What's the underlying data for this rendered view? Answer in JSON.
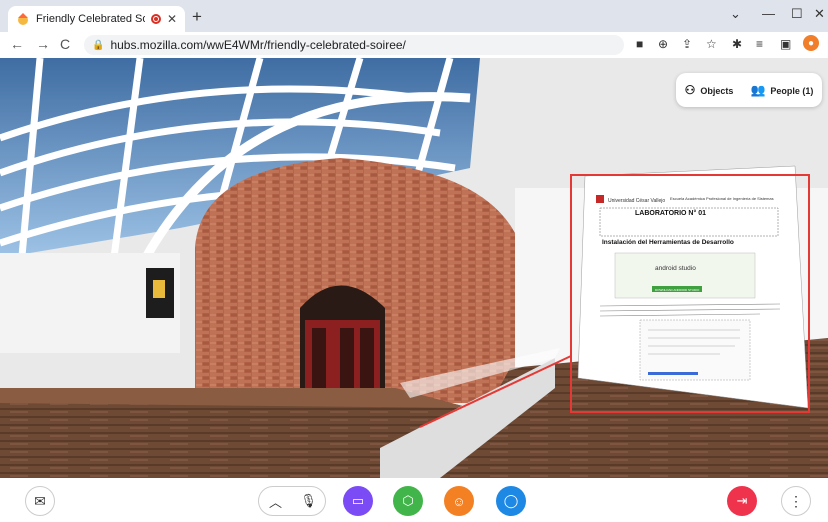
{
  "browser": {
    "tab_title": "Friendly Celebrated Soiree | ",
    "url": "hubs.mozilla.com/wwE4WMr/friendly-celebrated-soiree/",
    "window_controls": [
      "⌄",
      "—",
      "☐",
      "✕"
    ]
  },
  "scene": {
    "objects_label": "Objects",
    "people_label": "People (1)",
    "document": {
      "header_left": "Universidad César Vallejo",
      "header_right": "Escuela Académica Profesional de Ingeniería de Sistemas",
      "title": "LABORATORIO N° 01",
      "subtitle": "Instalación del Herramientas de Desarrollo",
      "android_studio": "android studio",
      "download_button": "DOWNLOAD ANDROID STUDIO"
    },
    "highlight_color": "#e53935"
  },
  "bottom_bar": {
    "buttons": [
      {
        "name": "invite",
        "color": "#ffffff"
      },
      {
        "name": "more-toggle",
        "color": "#ffffff"
      },
      {
        "name": "mic",
        "color": "#ffffff"
      },
      {
        "name": "share-screen",
        "color": "#7b4cf5"
      },
      {
        "name": "place-object",
        "color": "#41b549"
      },
      {
        "name": "react",
        "color": "#f48024"
      },
      {
        "name": "chat",
        "color": "#1e88e5"
      },
      {
        "name": "leave",
        "color": "#f0334d"
      },
      {
        "name": "menu",
        "color": "#ffffff"
      }
    ]
  }
}
